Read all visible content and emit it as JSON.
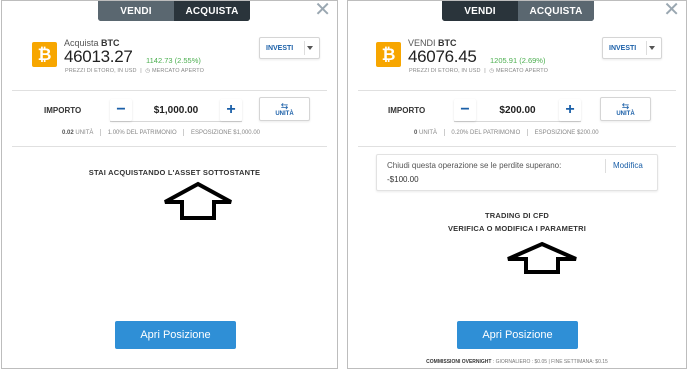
{
  "left": {
    "tabs": {
      "sell": "VENDI",
      "buy": "ACQUISTA",
      "active": "buy"
    },
    "asset": {
      "action": "Acquista",
      "symbol": "BTC",
      "price": "46013.27",
      "change": "1142.73 (2.55%)",
      "prices_note": "PREZZI DI ETORO, IN USD",
      "market_status": "MERCATO APERTO"
    },
    "investi_label": "INVESTI",
    "importo_label": "IMPORTO",
    "amount": "$1,000.00",
    "unita_label": "UNITÀ",
    "stats": {
      "units_value": "0.02",
      "units_label": "UNITÀ",
      "portfolio": "1.00% DEL PATRIMONIO",
      "exposure": "ESPOSIZIONE $1,000.00"
    },
    "info_text": "STAI ACQUISTANDO L'ASSET SOTTOSTANTE",
    "open_button": "Apri Posizione"
  },
  "right": {
    "tabs": {
      "sell": "VENDI",
      "buy": "ACQUISTA",
      "active": "buy"
    },
    "asset": {
      "action": "VENDI",
      "symbol": "BTC",
      "price": "46076.45",
      "change": "1205.91 (2.69%)",
      "prices_note": "PREZZI DI ETORO, IN USD",
      "market_status": "MERCATO APERTO"
    },
    "investi_label": "INVESTI",
    "importo_label": "IMPORTO",
    "amount": "$200.00",
    "unita_label": "UNITÀ",
    "stats": {
      "units_value": "0",
      "units_label": "UNITÀ",
      "portfolio": "0.20% DEL PATRIMONIO",
      "exposure": "ESPOSIZIONE $200.00"
    },
    "stop_loss": {
      "question": "Chiudi questa operazione se le perdite superano:",
      "value": "-$100.00",
      "edit": "Modifica"
    },
    "info_line1": "TRADING DI CFD",
    "info_line2": "VERIFICA O MODIFICA I PARAMETRI",
    "open_button": "Apri Posizione",
    "footer": {
      "label": "COMMISSIONI OVERNIGHT",
      "daily": "GIORNALIERO : $0.05",
      "weekend": "FINE SETTIMANA: $0.15"
    }
  },
  "colors": {
    "accent": "#1a5fa8",
    "button": "#2f8fd6",
    "btc": "#f7a600",
    "positive": "#4caf50",
    "tab_bar": "#3c4a54"
  },
  "icons": [
    "bitcoin-icon",
    "close-icon",
    "chevron-down-icon",
    "swap-icon",
    "minus-icon",
    "plus-icon",
    "clock-icon",
    "up-arrow-outline-icon"
  ]
}
